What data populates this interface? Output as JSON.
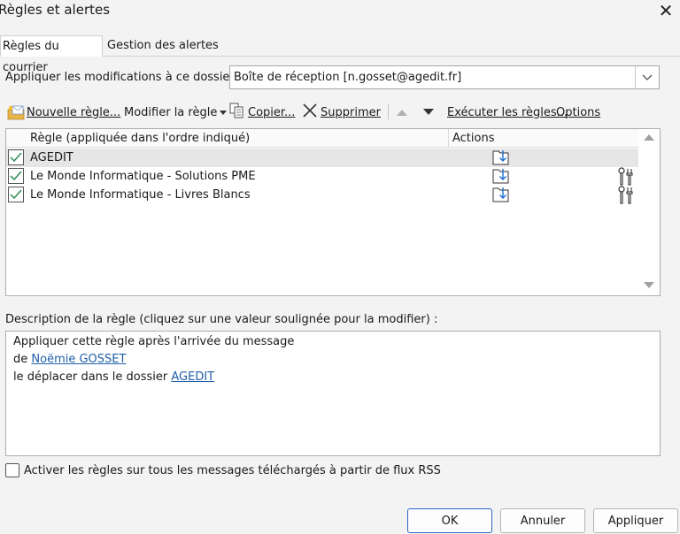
{
  "window": {
    "title": "Règles et alertes",
    "close_symbol": "✕"
  },
  "tabs": [
    {
      "label": "Règles du courrier",
      "active": true
    },
    {
      "label": "Gestion des alertes",
      "active": false
    }
  ],
  "folder": {
    "label": "Appliquer les modifications à ce dossier :",
    "value": "Boîte de réception [n.gosset@agedit.fr]"
  },
  "toolbar": {
    "new_rule": "Nouvelle règle...",
    "modify_rule": "Modifier la règle",
    "copy": "Copier...",
    "delete": "Supprimer",
    "run_rules": "Exécuter les règles...",
    "options": "Options"
  },
  "rules_table": {
    "col_rule": "Règle (appliquée dans l'ordre indiqué)",
    "col_actions": "Actions",
    "rows": [
      {
        "name": "AGEDIT",
        "checked": true,
        "selected": true,
        "has_condition_icon": false
      },
      {
        "name": "Le Monde Informatique - Solutions PME",
        "checked": true,
        "selected": false,
        "has_condition_icon": true
      },
      {
        "name": "Le Monde Informatique - Livres Blancs",
        "checked": true,
        "selected": false,
        "has_condition_icon": true
      }
    ]
  },
  "description": {
    "label": "Description de la règle (cliquez sur une valeur soulignée pour la modifier) :",
    "line1": "Appliquer cette règle après l'arrivée du message",
    "line2_prefix": "de ",
    "line2_link": "Noëmie GOSSET",
    "line3_prefix": "le déplacer dans le dossier ",
    "line3_link": "AGEDIT"
  },
  "rss": {
    "label": "Activer les règles sur tous les messages téléchargés à partir de flux RSS",
    "checked": false
  },
  "buttons": {
    "ok": "OK",
    "cancel": "Annuler",
    "apply": "Appliquer"
  },
  "colors": {
    "link": "#1f5fa8",
    "check": "#2e8b57",
    "ok_border": "#2f66c2"
  }
}
